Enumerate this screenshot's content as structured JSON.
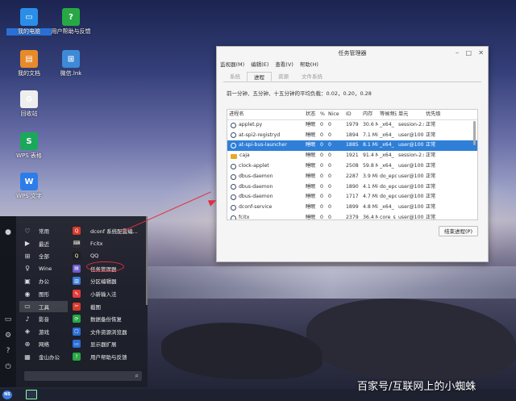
{
  "desktop": {
    "icons": [
      {
        "label": "我的电脑",
        "glyph": "▭",
        "color": "#2a8ee8"
      },
      {
        "label": "用户帮助与反馈",
        "glyph": "?",
        "color": "#27a844"
      },
      {
        "label": "我的文档",
        "glyph": "▤",
        "color": "#e88a2a"
      },
      {
        "label": "微信.lnk",
        "glyph": "⊞",
        "color": "#3d8ad8"
      },
      {
        "label": "回收站",
        "glyph": "♻",
        "color": "#eeeeee"
      },
      {
        "label": "WPS 表格",
        "glyph": "S",
        "color": "#1aa85b"
      },
      {
        "label": "WPS 文字",
        "glyph": "W",
        "color": "#2b7de9"
      }
    ]
  },
  "window": {
    "title": "任务管理器",
    "menus": [
      "监视器(M)",
      "编辑(E)",
      "查看(V)",
      "帮助(H)"
    ],
    "tabs": [
      "系统",
      "进程",
      "资源",
      "文件系统"
    ],
    "active_tab": "进程",
    "load_text": "前一分钟、五分钟、十五分钟的平均负载：0.02，0.20，0.28",
    "columns": [
      "进程名",
      "状态",
      "%",
      "Nice",
      "ID",
      "内存",
      "等候频道",
      "单元",
      "优先级"
    ],
    "rows": [
      {
        "name": "applet.py",
        "status": "睡眠",
        "cpu": "0",
        "nice": "0",
        "id": "1979",
        "mem": "30.6 Mi",
        "wchan": "_x64_",
        "unit": "session-2.s",
        "prio": "正常"
      },
      {
        "name": "at-spi2-registryd",
        "status": "睡眠",
        "cpu": "0",
        "nice": "0",
        "id": "1894",
        "mem": "7.1 MiE",
        "wchan": "_x64_",
        "unit": "user@100(",
        "prio": "正常"
      },
      {
        "name": "at-spi-bus-launcher",
        "status": "睡眠",
        "cpu": "0",
        "nice": "0",
        "id": "1885",
        "mem": "8.1 MiE",
        "wchan": "_x64_",
        "unit": "user@100(",
        "prio": "正常"
      },
      {
        "name": "caja",
        "status": "睡眠",
        "cpu": "0",
        "nice": "0",
        "id": "1921",
        "mem": "91.4 Mi",
        "wchan": "_x64_",
        "unit": "session-2.s",
        "prio": "正常"
      },
      {
        "name": "clock-applet",
        "status": "睡眠",
        "cpu": "0",
        "nice": "0",
        "id": "2508",
        "mem": "59.8 Mi",
        "wchan": "_x64_",
        "unit": "user@100(",
        "prio": "正常"
      },
      {
        "name": "dbus-daemon",
        "status": "睡眠",
        "cpu": "0",
        "nice": "0",
        "id": "2287",
        "mem": "3.9 MiE",
        "wchan": "do_epc",
        "unit": "user@100(",
        "prio": "正常"
      },
      {
        "name": "dbus-daemon",
        "status": "睡眠",
        "cpu": "0",
        "nice": "0",
        "id": "1890",
        "mem": "4.1 MiE",
        "wchan": "do_epc",
        "unit": "user@100(",
        "prio": "正常"
      },
      {
        "name": "dbus-daemon",
        "status": "睡眠",
        "cpu": "0",
        "nice": "0",
        "id": "1717",
        "mem": "4.7 MiE",
        "wchan": "do_epc",
        "unit": "user@100(",
        "prio": "正常"
      },
      {
        "name": "dconf-service",
        "status": "睡眠",
        "cpu": "0",
        "nice": "0",
        "id": "1899",
        "mem": "4.8 MiE",
        "wchan": "_x64_",
        "unit": "user@100(",
        "prio": "正常"
      },
      {
        "name": "fcitx",
        "status": "睡眠",
        "cpu": "0",
        "nice": "0",
        "id": "2379",
        "mem": "36.4 Mi",
        "wchan": "core_s",
        "unit": "user@100(",
        "prio": "正常"
      }
    ],
    "selected_row": 2,
    "end_button": "结束进程(P)"
  },
  "startmenu": {
    "categories": [
      {
        "label": "常用",
        "glyph": "♡"
      },
      {
        "label": "最近",
        "glyph": "▶"
      },
      {
        "label": "全部",
        "glyph": "⊞"
      },
      {
        "label": "Wine",
        "glyph": "♀"
      },
      {
        "label": "办公",
        "glyph": "▣"
      },
      {
        "label": "图形",
        "glyph": "◉"
      },
      {
        "label": "工具",
        "glyph": "▭"
      },
      {
        "label": "影音",
        "glyph": "♪"
      },
      {
        "label": "游戏",
        "glyph": "◈"
      },
      {
        "label": "网络",
        "glyph": "⊕"
      },
      {
        "label": "金山办公",
        "glyph": "▦"
      }
    ],
    "active_category": "工具",
    "apps": [
      {
        "label": "dconf 系统配置编...",
        "color": "#d83a2a",
        "glyph": "Q"
      },
      {
        "label": "Fcitx",
        "color": "#2f2f2f",
        "glyph": "⌨"
      },
      {
        "label": "QQ",
        "color": "#1e1e1e",
        "glyph": "Q"
      },
      {
        "label": "任务管理器",
        "color": "#6a5acd",
        "glyph": "▤"
      },
      {
        "label": "分区编辑器",
        "color": "#3a7bd5",
        "glyph": "▥"
      },
      {
        "label": "小新输入法",
        "color": "#e83a3a",
        "glyph": "✎"
      },
      {
        "label": "截图",
        "color": "#d83a2a",
        "glyph": "✂"
      },
      {
        "label": "数据备份恢复",
        "color": "#27a844",
        "glyph": "⟳"
      },
      {
        "label": "文件资源浏览器",
        "color": "#2b6fd6",
        "glyph": "▢"
      },
      {
        "label": "显示器扩展",
        "color": "#2b6fd6",
        "glyph": "▭"
      },
      {
        "label": "用户帮助与反馈",
        "color": "#27a844",
        "glyph": "?"
      }
    ],
    "highlighted_app": "任务管理器",
    "side_icons": [
      "user-icon",
      "monitor-icon",
      "settings-icon",
      "help-icon",
      "power-icon"
    ]
  },
  "taskbar": {
    "start_label": "NS"
  },
  "watermark": "百家号/互联网上的小蜘蛛",
  "annotation_color": "#e0303a"
}
